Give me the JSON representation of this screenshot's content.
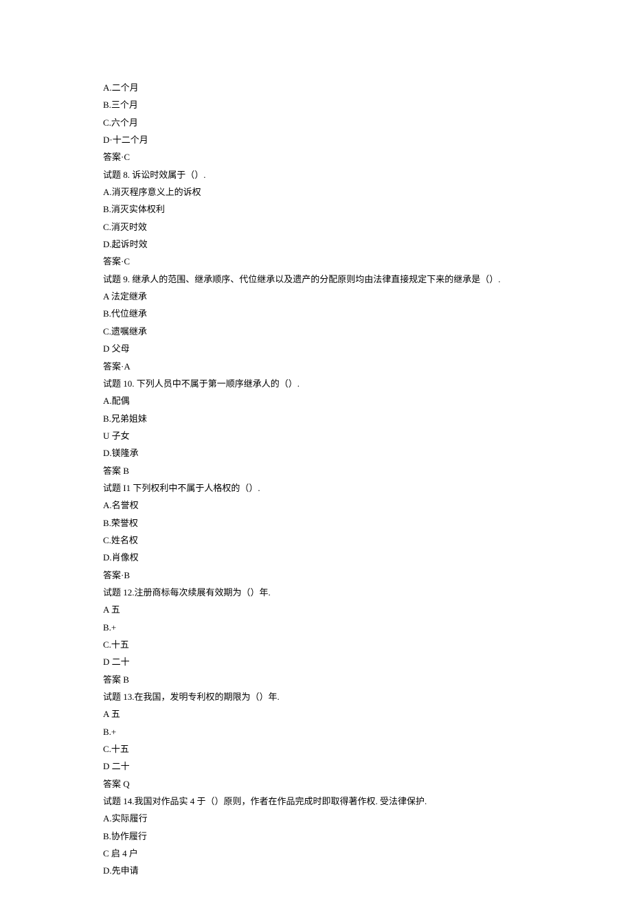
{
  "lines": [
    "A.二个月",
    "B.三个月",
    "C.六个月",
    "D·十二个月",
    "答案·C",
    "试题 8. 诉讼时效属于（）.",
    "A.消灭程序意义上的诉权",
    "B.消灭实体权利",
    "C.消灭时效",
    "D.起诉时效",
    "答案·C",
    "试题 9. 继承人的范围、继承顺序、代位继承以及遗产的分配原则均由法律直接规定下来的继承是（）.",
    "A 法定继承",
    "B.代位继承",
    "C.遗嘱继承",
    "D 父母",
    "答案·A",
    "试题 10. 下列人员中不属于第一顺序继承人的（）.",
    "A.配偶",
    "B.兄弟姐妹",
    "U 子女",
    "D.镁隆承",
    "答案 B",
    "试题 I1 下列权利中不属于人格权的（）.",
    "A.名誉权",
    "B.荣誉权",
    "C.姓名权",
    "D.肖像权",
    "答案·B",
    "试题 12.注册商标每次续展有效期为（）年.",
    "A 五",
    "B.+",
    "C.十五",
    "D 二十",
    "答案 B",
    "试题 13.在我国，发明专利权的期限为（）年.",
    "A 五",
    "B.+",
    "C.十五",
    "D 二十",
    "答案 Q",
    "试题 14.我国对作品实 4 于（）原则，作者在作品完成时即取得著作权. 受法律保护.",
    "A.实际履行",
    "B.协作履行",
    "C 启 4 户",
    "D.先申请"
  ]
}
